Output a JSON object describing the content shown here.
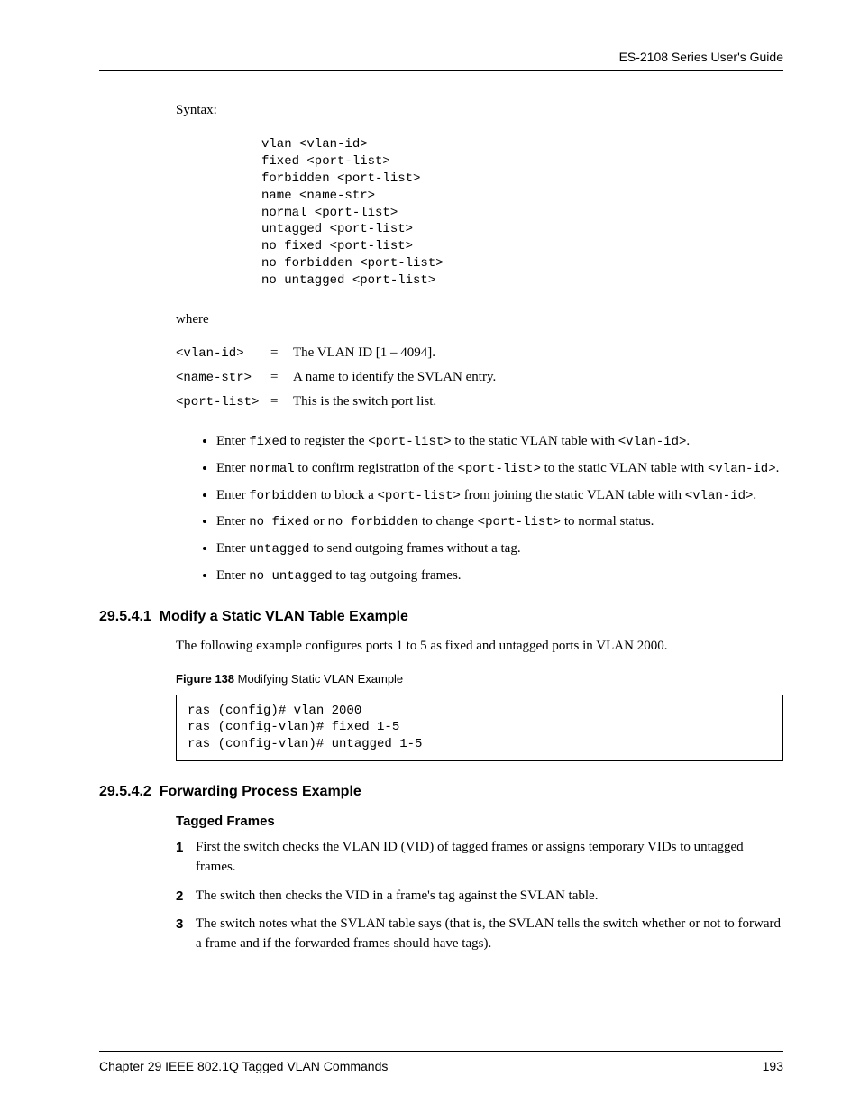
{
  "header": {
    "guide": "ES-2108 Series User's Guide"
  },
  "syntax_label": "Syntax:",
  "syntax_block": "vlan <vlan-id>\nfixed <port-list>\nforbidden <port-list>\nname <name-str>\nnormal <port-list>\nuntagged <port-list>\nno fixed <port-list>\nno forbidden <port-list>\nno untagged <port-list>",
  "where_label": "where",
  "defs": {
    "t1": "<vlan-id>",
    "d1": "The VLAN ID [1 – 4094].",
    "t2": "<name-str>",
    "d2": "A name to identify the SVLAN entry.",
    "t3": "<port-list>",
    "d3": "This is the switch port list."
  },
  "eq": "=",
  "bullets": {
    "b1a": "Enter ",
    "b1b": "fixed",
    "b1c": " to register the ",
    "b1d": "<port-list>",
    "b1e": " to the static VLAN table with ",
    "b1f": "<vlan-id>",
    "b1g": ".",
    "b2a": "Enter ",
    "b2b": "normal",
    "b2c": " to confirm registration of the ",
    "b2d": "<port-list>",
    "b2e": " to the static VLAN table with ",
    "b2f": "<vlan-id>",
    "b2g": ".",
    "b3a": "Enter ",
    "b3b": "forbidden",
    "b3c": " to block a ",
    "b3d": "<port-list>",
    "b3e": " from joining the static VLAN table with ",
    "b3f": "<vlan-id>",
    "b3g": ".",
    "b4a": "Enter ",
    "b4b": "no fixed",
    "b4c": " or ",
    "b4d": "no forbidden",
    "b4e": " to change ",
    "b4f": "<port-list>",
    "b4g": " to normal status.",
    "b5a": "Enter ",
    "b5b": "untagged",
    "b5c": " to send outgoing frames without a tag.",
    "b6a": "Enter ",
    "b6b": "no untagged",
    "b6c": " to tag outgoing frames."
  },
  "sec1": {
    "num": "29.5.4.1",
    "title": "Modify a Static VLAN Table Example",
    "intro": "The following example configures ports 1 to 5 as fixed and untagged ports in VLAN 2000.",
    "figlabel": "Figure 138",
    "figcap": "   Modifying Static VLAN Example",
    "code": "ras (config)# vlan 2000\nras (config-vlan)# fixed 1-5\nras (config-vlan)# untagged 1-5"
  },
  "sec2": {
    "num": "29.5.4.2",
    "title": "Forwarding Process Example",
    "sub": "Tagged Frames",
    "steps": {
      "s1": "First the switch checks the VLAN ID (VID) of tagged frames or assigns temporary VIDs to untagged frames.",
      "s2": "The switch then checks the VID in a frame's tag against the SVLAN table.",
      "s3": "The switch notes what the SVLAN table says (that is, the SVLAN tells the switch whether or not to forward a frame and if the forwarded frames should have tags)."
    }
  },
  "footer": {
    "chapter": "Chapter 29 IEEE 802.1Q Tagged VLAN Commands",
    "page": "193"
  }
}
